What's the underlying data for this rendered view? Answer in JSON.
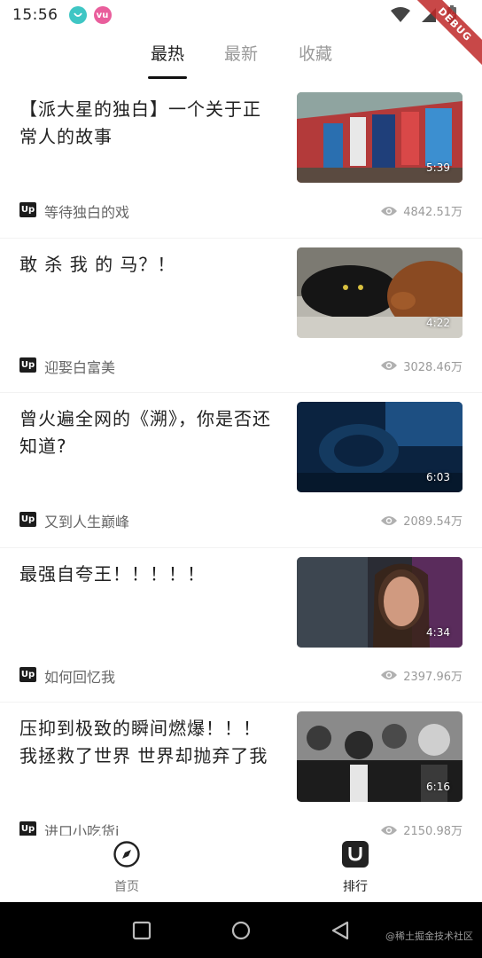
{
  "status_bar": {
    "time": "15:56",
    "notif_text": "vu",
    "debug_label": "DEBUG"
  },
  "tabs": [
    {
      "label": "最热",
      "active": true
    },
    {
      "label": "最新",
      "active": false
    },
    {
      "label": "收藏",
      "active": false
    }
  ],
  "videos": [
    {
      "title": "【派大星的独白】一个关于正常人的故事",
      "duration": "5:39",
      "badge": "Up",
      "author": "等待独白的戏",
      "views": "4842.51万"
    },
    {
      "title": "敢 杀 我 的 马？！",
      "duration": "4:22",
      "badge": "Up",
      "author": "迎娶白富美",
      "views": "3028.46万"
    },
    {
      "title": "曾火遍全网的《溯》，你是否还知道?",
      "duration": "6:03",
      "badge": "Up",
      "author": "又到人生巅峰",
      "views": "2089.54万"
    },
    {
      "title": "最强自夸王！！！！！",
      "duration": "4:34",
      "badge": "Up",
      "author": "如何回忆我",
      "views": "2397.96万"
    },
    {
      "title": "压抑到极致的瞬间燃爆！！！我拯救了世界 世界却抛弃了我",
      "duration": "6:16",
      "badge": "Up",
      "author": "进口小吃货i",
      "views": "2150.98万"
    }
  ],
  "bottom_nav": [
    {
      "label": "首页",
      "icon": "compass-icon",
      "active": false
    },
    {
      "label": "排行",
      "icon": "rank-icon",
      "active": true
    }
  ],
  "watermark": "@稀土掘金技术社区",
  "colors": {
    "accent": "#222222",
    "muted": "#9a9a9a",
    "debug": "#be2828"
  }
}
